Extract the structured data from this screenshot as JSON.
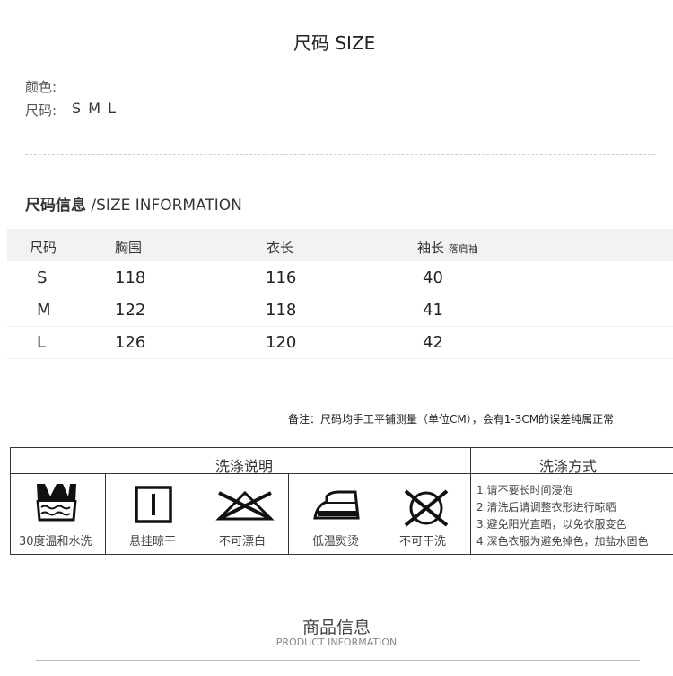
{
  "header": {
    "title": "尺码 SIZE"
  },
  "info": {
    "color_label": "颜色:",
    "size_label": "尺码:",
    "sizes": "S M L"
  },
  "section": {
    "title_cn": "尺码信息",
    "title_en": "/SIZE INFORMATION"
  },
  "table": {
    "headers": [
      "尺码",
      "胸围",
      "衣长",
      "袖长"
    ],
    "sleeve_note": "落肩袖",
    "rows": [
      [
        "S",
        "118",
        "116",
        "40"
      ],
      [
        "M",
        "122",
        "118",
        "41"
      ],
      [
        "L",
        "126",
        "120",
        "42"
      ]
    ]
  },
  "note": "备注：尺码均手工平铺测量（单位CM），会有1-3CM的误差纯属正常",
  "care": {
    "title_left": "洗涤说明",
    "title_right": "洗涤方式",
    "icons": [
      {
        "icon": "hand-wash-30-icon",
        "label": "30度温和水洗"
      },
      {
        "icon": "hang-dry-icon",
        "label": "悬挂晾干"
      },
      {
        "icon": "no-bleach-icon",
        "label": "不可漂白"
      },
      {
        "icon": "low-iron-icon",
        "label": "低温熨烫"
      },
      {
        "icon": "no-dry-clean-icon",
        "label": "不可干洗"
      }
    ],
    "rules": [
      "1.请不要长时间浸泡",
      "2.清洗后请调整衣形进行晾晒",
      "3.避免阳光直晒，以免衣服变色",
      "4.深色衣服为避免掉色，加盐水固色"
    ]
  },
  "footer": {
    "title_cn": "商品信息",
    "title_en": "PRODUCT INFORMATION"
  }
}
